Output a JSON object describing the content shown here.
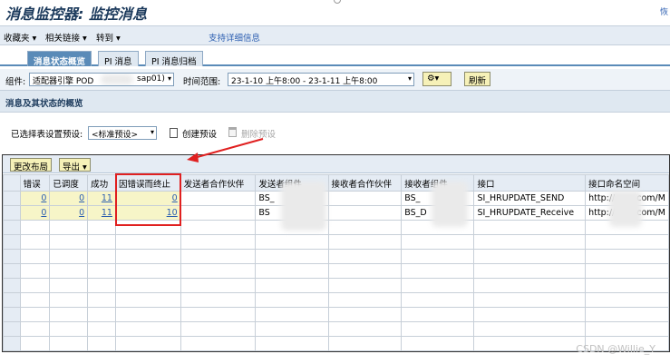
{
  "window": {
    "title": "消息监控器: 监控消息",
    "right_link": "恢"
  },
  "menu": {
    "items": [
      "收藏夹",
      "相关链接",
      "转到"
    ],
    "support_link": "支持详细信息"
  },
  "tabs": [
    "消息状态概览",
    "PI 消息",
    "PI 消息归档"
  ],
  "filters": {
    "component_label": "组件:",
    "component_value": "适配器引擎 POD",
    "component_suffix": "sap01)",
    "time_label": "时间范围:",
    "time_value": "23-1-10 上午8:00 - 23-1-11 上午8:00",
    "refresh_label": "刷新"
  },
  "section": {
    "title": "消息及其状态的概览"
  },
  "preset": {
    "label": "已选择表设置预设:",
    "value": "<标准预设>",
    "create_label": "创建预设",
    "delete_label": "删除预设"
  },
  "grid_toolbar": {
    "change_layout": "更改布局",
    "export": "导出"
  },
  "table": {
    "columns": [
      "错误",
      "已调度",
      "成功",
      "因错误而终止",
      "发送者合作伙伴",
      "发送者组件",
      "接收者合作伙伴",
      "接收者组件",
      "接口",
      "接口命名空间"
    ],
    "rows": [
      {
        "error": "0",
        "scheduled": "0",
        "success": "11",
        "terminated": "0",
        "sender_partner": "",
        "sender_component": "BS_",
        "receiver_partner": "",
        "receiver_component": "BS_",
        "interface": "SI_HRUPDATE_SEND",
        "namespace": "http://",
        "namespace_tail": "com/M"
      },
      {
        "error": "0",
        "scheduled": "0",
        "success": "11",
        "terminated": "10",
        "sender_partner": "",
        "sender_component": "BS",
        "receiver_partner": "",
        "receiver_component": "BS_D",
        "interface": "SI_HRUPDATE_Receive",
        "namespace": "http://",
        "namespace_tail": "com/M"
      }
    ]
  },
  "watermark": "CSDN @Willie_Y",
  "colors": {
    "accent": "#5a8bb8",
    "highlight": "#e02020",
    "button_bg": "#f6f1b8",
    "link": "#2a5db0"
  }
}
